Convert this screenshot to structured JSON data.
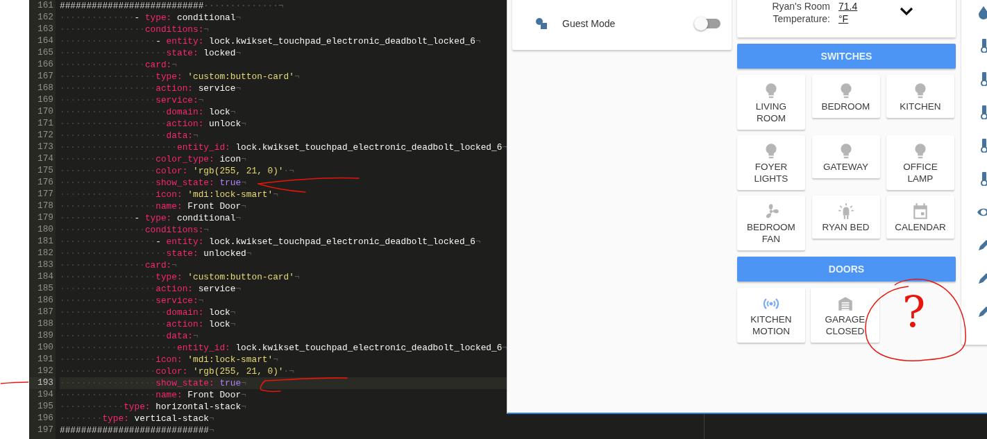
{
  "editor": {
    "lines": [
      {
        "n": "161",
        "parts": [
          {
            "kind": "comment",
            "text": "###########################"
          },
          {
            "kind": "space",
            "text": "··············"
          }
        ],
        "eol": "¬",
        "current": false
      },
      {
        "n": "162",
        "indent": "··············",
        "parts": [
          {
            "kind": "punct",
            "text": "- "
          },
          {
            "kind": "key",
            "text": "type:"
          },
          {
            "kind": "value",
            "text": " conditional"
          }
        ],
        "eol": "¬",
        "current": false
      },
      {
        "n": "163",
        "indent": "················",
        "parts": [
          {
            "kind": "key",
            "text": "conditions:"
          }
        ],
        "eol": "¬",
        "current": false
      },
      {
        "n": "164",
        "indent": "··················",
        "parts": [
          {
            "kind": "punct",
            "text": "- "
          },
          {
            "kind": "key",
            "text": "entity:"
          },
          {
            "kind": "value",
            "text": " lock.kwikset_touchpad_electronic_deadbolt_locked_6"
          }
        ],
        "eol": "¬",
        "current": false
      },
      {
        "n": "165",
        "indent": "····················",
        "parts": [
          {
            "kind": "key",
            "text": "state:"
          },
          {
            "kind": "value",
            "text": " locked"
          }
        ],
        "eol": "¬",
        "current": false
      },
      {
        "n": "166",
        "indent": "················",
        "parts": [
          {
            "kind": "key",
            "text": "card:"
          }
        ],
        "eol": "¬",
        "current": false
      },
      {
        "n": "167",
        "indent": "··················",
        "parts": [
          {
            "kind": "key",
            "text": "type:"
          },
          {
            "kind": "string",
            "text": " 'custom:button-card'"
          }
        ],
        "eol": "¬",
        "current": false
      },
      {
        "n": "168",
        "indent": "··················",
        "parts": [
          {
            "kind": "key",
            "text": "action:"
          },
          {
            "kind": "value",
            "text": " service"
          }
        ],
        "eol": "¬",
        "current": false
      },
      {
        "n": "169",
        "indent": "··················",
        "parts": [
          {
            "kind": "key",
            "text": "service:"
          }
        ],
        "eol": "¬",
        "current": false
      },
      {
        "n": "170",
        "indent": "····················",
        "parts": [
          {
            "kind": "key",
            "text": "domain:"
          },
          {
            "kind": "value",
            "text": " lock"
          }
        ],
        "eol": "¬",
        "current": false
      },
      {
        "n": "171",
        "indent": "····················",
        "parts": [
          {
            "kind": "key",
            "text": "action:"
          },
          {
            "kind": "value",
            "text": " unlock"
          }
        ],
        "eol": "¬",
        "current": false
      },
      {
        "n": "172",
        "indent": "····················",
        "parts": [
          {
            "kind": "key",
            "text": "data:"
          }
        ],
        "eol": "¬",
        "current": false
      },
      {
        "n": "173",
        "indent": "······················",
        "parts": [
          {
            "kind": "key",
            "text": "entity_id:"
          },
          {
            "kind": "value",
            "text": " lock.kwikset_touchpad_electronic_deadbolt_locked_6"
          }
        ],
        "eol": "¬",
        "current": false
      },
      {
        "n": "174",
        "indent": "··················",
        "parts": [
          {
            "kind": "key",
            "text": "color_type:"
          },
          {
            "kind": "value",
            "text": " icon"
          }
        ],
        "eol": "¬",
        "current": false
      },
      {
        "n": "175",
        "indent": "··················",
        "parts": [
          {
            "kind": "key",
            "text": "color:"
          },
          {
            "kind": "string",
            "text": " 'rgb(255, 21, 0)'"
          },
          {
            "kind": "space",
            "text": "·"
          }
        ],
        "eol": "¬",
        "current": false
      },
      {
        "n": "176",
        "indent": "··················",
        "parts": [
          {
            "kind": "key",
            "text": "show_state:"
          },
          {
            "kind": "bool",
            "text": " true"
          }
        ],
        "eol": "¬",
        "current": false,
        "arrow": true
      },
      {
        "n": "177",
        "indent": "··················",
        "parts": [
          {
            "kind": "key",
            "text": "icon:"
          },
          {
            "kind": "string",
            "text": " 'mdi:lock-smart'"
          }
        ],
        "eol": "¬",
        "current": false
      },
      {
        "n": "178",
        "indent": "··················",
        "parts": [
          {
            "kind": "key",
            "text": "name:"
          },
          {
            "kind": "value",
            "text": " Front Door"
          }
        ],
        "eol": "¬",
        "current": false
      },
      {
        "n": "179",
        "indent": "··············",
        "parts": [
          {
            "kind": "punct",
            "text": "- "
          },
          {
            "kind": "key",
            "text": "type:"
          },
          {
            "kind": "value",
            "text": " conditional"
          }
        ],
        "eol": "¬",
        "current": false
      },
      {
        "n": "180",
        "indent": "················",
        "parts": [
          {
            "kind": "key",
            "text": "conditions:"
          }
        ],
        "eol": "¬",
        "current": false
      },
      {
        "n": "181",
        "indent": "··················",
        "parts": [
          {
            "kind": "punct",
            "text": "- "
          },
          {
            "kind": "key",
            "text": "entity:"
          },
          {
            "kind": "value",
            "text": " lock.kwikset_touchpad_electronic_deadbolt_locked_6"
          }
        ],
        "eol": "¬",
        "current": false
      },
      {
        "n": "182",
        "indent": "····················",
        "parts": [
          {
            "kind": "key",
            "text": "state:"
          },
          {
            "kind": "value",
            "text": " unlocked"
          }
        ],
        "eol": "¬",
        "current": false
      },
      {
        "n": "183",
        "indent": "················",
        "parts": [
          {
            "kind": "key",
            "text": "card:"
          }
        ],
        "eol": "¬",
        "current": false
      },
      {
        "n": "184",
        "indent": "··················",
        "parts": [
          {
            "kind": "key",
            "text": "type:"
          },
          {
            "kind": "string",
            "text": " 'custom:button-card'"
          }
        ],
        "eol": "¬",
        "current": false
      },
      {
        "n": "185",
        "indent": "··················",
        "parts": [
          {
            "kind": "key",
            "text": "action:"
          },
          {
            "kind": "value",
            "text": " service"
          }
        ],
        "eol": "¬",
        "current": false
      },
      {
        "n": "186",
        "indent": "··················",
        "parts": [
          {
            "kind": "key",
            "text": "service:"
          }
        ],
        "eol": "¬",
        "current": false
      },
      {
        "n": "187",
        "indent": "····················",
        "parts": [
          {
            "kind": "key",
            "text": "domain:"
          },
          {
            "kind": "value",
            "text": " lock"
          }
        ],
        "eol": "¬",
        "current": false
      },
      {
        "n": "188",
        "indent": "····················",
        "parts": [
          {
            "kind": "key",
            "text": "action:"
          },
          {
            "kind": "value",
            "text": " lock"
          }
        ],
        "eol": "¬",
        "current": false
      },
      {
        "n": "189",
        "indent": "····················",
        "parts": [
          {
            "kind": "key",
            "text": "data:"
          }
        ],
        "eol": "¬",
        "current": false
      },
      {
        "n": "190",
        "indent": "······················",
        "parts": [
          {
            "kind": "key",
            "text": "entity_id:"
          },
          {
            "kind": "value",
            "text": " lock.kwikset_touchpad_electronic_deadbolt_locked_6"
          }
        ],
        "eol": "¬",
        "current": false
      },
      {
        "n": "191",
        "indent": "··················",
        "parts": [
          {
            "kind": "key",
            "text": "icon:"
          },
          {
            "kind": "string",
            "text": " 'mdi:lock-smart'"
          }
        ],
        "eol": "¬",
        "current": false
      },
      {
        "n": "192",
        "indent": "··················",
        "parts": [
          {
            "kind": "key",
            "text": "color:"
          },
          {
            "kind": "string",
            "text": " 'rgb(255, 21, 0)'"
          },
          {
            "kind": "space",
            "text": "·"
          }
        ],
        "eol": "¬",
        "current": false
      },
      {
        "n": "193",
        "indent": "··················",
        "parts": [
          {
            "kind": "key",
            "text": "show_state:"
          },
          {
            "kind": "bool",
            "text": " true"
          }
        ],
        "eol": "¬",
        "current": true,
        "arrow": true,
        "margin_mark": true
      },
      {
        "n": "194",
        "indent": "··················",
        "parts": [
          {
            "kind": "key",
            "text": "name:"
          },
          {
            "kind": "value",
            "text": " Front Door"
          }
        ],
        "eol": "¬",
        "current": false
      },
      {
        "n": "195",
        "indent": "············",
        "parts": [
          {
            "kind": "key",
            "text": "type:"
          },
          {
            "kind": "value",
            "text": " horizontal-stack"
          }
        ],
        "eol": "¬",
        "current": false
      },
      {
        "n": "196",
        "indent": "········",
        "parts": [
          {
            "kind": "key",
            "text": "type:"
          },
          {
            "kind": "value",
            "text": " vertical-stack"
          }
        ],
        "eol": "¬",
        "current": false
      },
      {
        "n": "197",
        "parts": [
          {
            "kind": "comment",
            "text": "############################"
          }
        ],
        "eol": "¬",
        "current": false
      }
    ]
  },
  "dashboard": {
    "guest_mode": {
      "label": "Guest Mode",
      "on": false
    },
    "sensor": {
      "label": "Ryan's Room Temperature:",
      "value": "71.4 °F"
    },
    "sections": [
      {
        "title": "SWITCHES",
        "tiles": [
          {
            "label": "LIVING ROOM",
            "kind": "light",
            "on": false
          },
          {
            "label": "BEDROOM",
            "kind": "light",
            "on": false
          },
          {
            "label": "KITCHEN",
            "kind": "light",
            "on": false
          },
          {
            "label": "FOYER LIGHTS",
            "kind": "light",
            "on": false
          },
          {
            "label": "GATEWAY",
            "kind": "light",
            "on": false
          },
          {
            "label": "OFFICE LAMP",
            "kind": "light",
            "on": false
          },
          {
            "label": "BEDROOM FAN",
            "kind": "fan",
            "on": false
          },
          {
            "label": "RYAN BED",
            "kind": "led",
            "on": false
          },
          {
            "label": "CALENDAR",
            "kind": "calendar",
            "on": false
          }
        ]
      },
      {
        "title": "DOORS",
        "tiles": [
          {
            "label": "KITCHEN MOTION",
            "kind": "motion",
            "on": true
          },
          {
            "label": "GARAGE CLOSED",
            "kind": "garage",
            "on": false
          }
        ],
        "scribble": "?"
      }
    ]
  }
}
